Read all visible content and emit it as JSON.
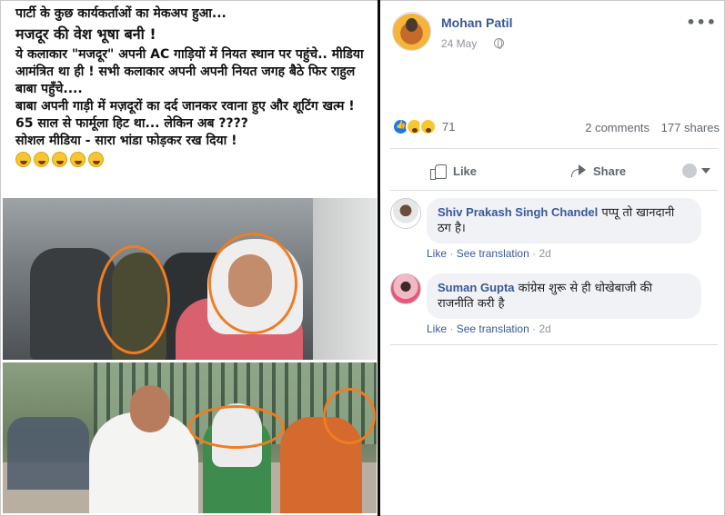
{
  "left_image": {
    "lines": [
      "पार्टी के कुछ कार्यकर्ताओं का मेकअप हुआ...",
      "मजदूर की वेश भूषा बनी !",
      "ये कलाकार \"मजदूर\" अपनी AC गाड़ियों में नियत स्थान पर पहुंचे.. मीडिया आमंत्रित था ही ! सभी कलाकार अपनी अपनी नियत जगह बैठे फिर राहुल बाबा पहुँचे....",
      "बाबा अपनी गाड़ी में मज़दूरों का दर्द जानकर रवाना हुए और शूटिंग खत्म !",
      "65 साल से फार्मूला हिट था... लेकिन अब ????",
      "सोशल मीडिया - सारा भांडा फोड़कर रख दिया !"
    ],
    "emoji_icons": [
      "laughing-emoji-icon",
      "rofl-emoji-icon",
      "laughing-emoji-icon",
      "squint-tongue-emoji-icon",
      "grin-emoji-icon"
    ],
    "highlight_color": "#ef7d22"
  },
  "post": {
    "author": "Mohan Patil",
    "date": "24 May",
    "reactions": {
      "icons": [
        "like-reaction-icon",
        "haha-reaction-icon",
        "wow-reaction-icon"
      ],
      "count": "71"
    },
    "comments_count": "2 comments",
    "shares_count": "177 shares",
    "actions": {
      "like": "Like",
      "share": "Share"
    }
  },
  "comments": [
    {
      "name": "Shiv Prakash Singh Chandel",
      "text": "पप्पू तो खानदानी ठग है।",
      "like": "Like",
      "see_translation": "See translation",
      "time": "2d"
    },
    {
      "name": "Suman Gupta",
      "text": "कांग्रेस शुरू से ही धोखेबाजी की राजनीति करी है",
      "like": "Like",
      "see_translation": "See translation",
      "time": "2d"
    }
  ],
  "colors": {
    "link_blue": "#385898",
    "secondary_text": "#90949c",
    "bubble_bg": "#f0f2f5"
  }
}
